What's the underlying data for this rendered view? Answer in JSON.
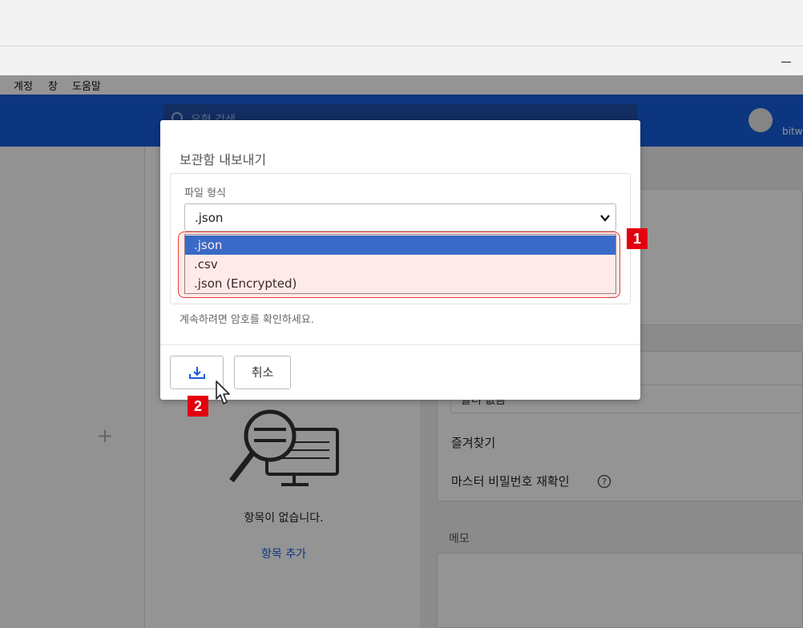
{
  "menu": {
    "items": [
      "계정",
      "창",
      "도움말"
    ]
  },
  "header": {
    "search_placeholder": "유형 검색",
    "username": "bitw"
  },
  "middle": {
    "empty_text": "항목이 없습니다.",
    "add_item_link": "항목 추가"
  },
  "right": {
    "no_folder": "폴더 없음",
    "favorite": "즐겨찾기",
    "master_password_reprompt": "마스터 비밀번호 재확인",
    "memo_label": "메모"
  },
  "modal": {
    "title": "보관함 내보내기",
    "format_label": "파일 형식",
    "selected_format": ".json",
    "options": [
      ".json",
      ".csv",
      ".json (Encrypted)"
    ],
    "hint": "계속하려면 암호를 확인하세요.",
    "cancel_label": "취소"
  },
  "annotations": {
    "badge1": "1",
    "badge2": "2",
    "highlight_color": "#e3000f"
  },
  "colors": {
    "header_blue": "#175ddc",
    "selected_option": "#1e6ed8"
  }
}
